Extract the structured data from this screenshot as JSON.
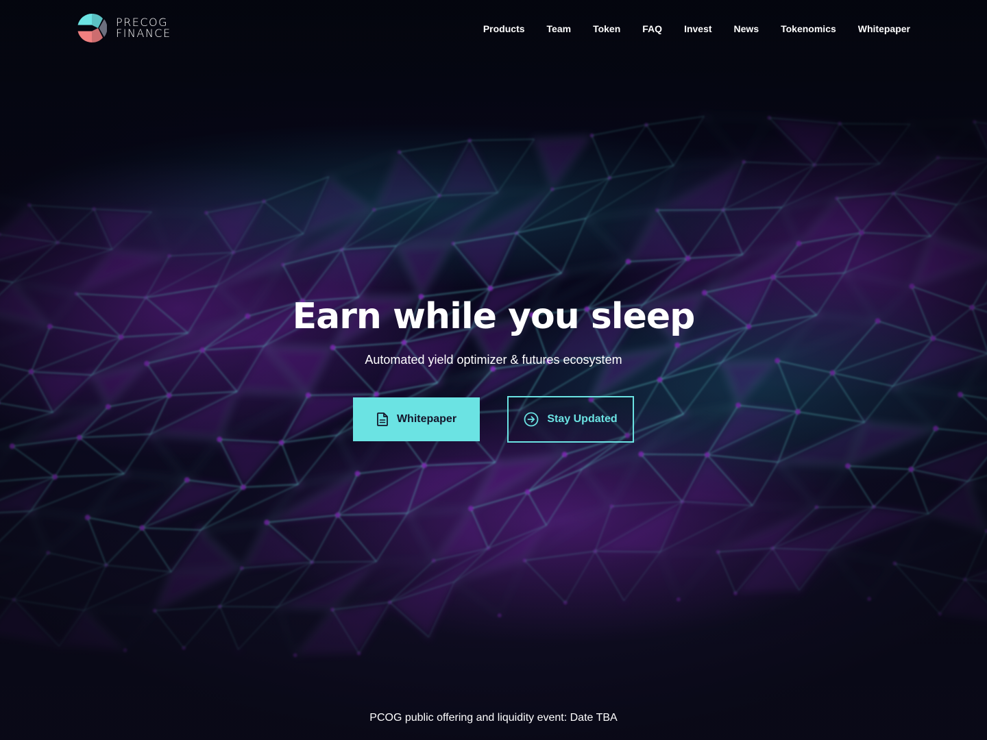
{
  "brand": {
    "name_line1": "PRECOG",
    "name_line2": "FINANCE"
  },
  "nav": {
    "items": [
      {
        "label": "Products"
      },
      {
        "label": "Team"
      },
      {
        "label": "Token"
      },
      {
        "label": "FAQ"
      },
      {
        "label": "Invest"
      },
      {
        "label": "News"
      },
      {
        "label": "Tokenomics"
      },
      {
        "label": "Whitepaper"
      }
    ]
  },
  "hero": {
    "title": "Earn while you sleep",
    "subtitle": "Automated yield optimizer & futures ecosystem",
    "primary_button": {
      "label": "Whitepaper",
      "icon": "document-icon"
    },
    "secondary_button": {
      "label": "Stay Updated",
      "icon": "arrow-circle-right-icon"
    }
  },
  "footer": {
    "note": "PCOG public offering and liquidity event: Date TBA"
  },
  "colors": {
    "accent_cyan": "#6be3e3",
    "accent_purple": "#8a2bc4",
    "background": "#05060f",
    "logo_coral": "#f08080",
    "logo_gray": "#6c6f7e"
  }
}
